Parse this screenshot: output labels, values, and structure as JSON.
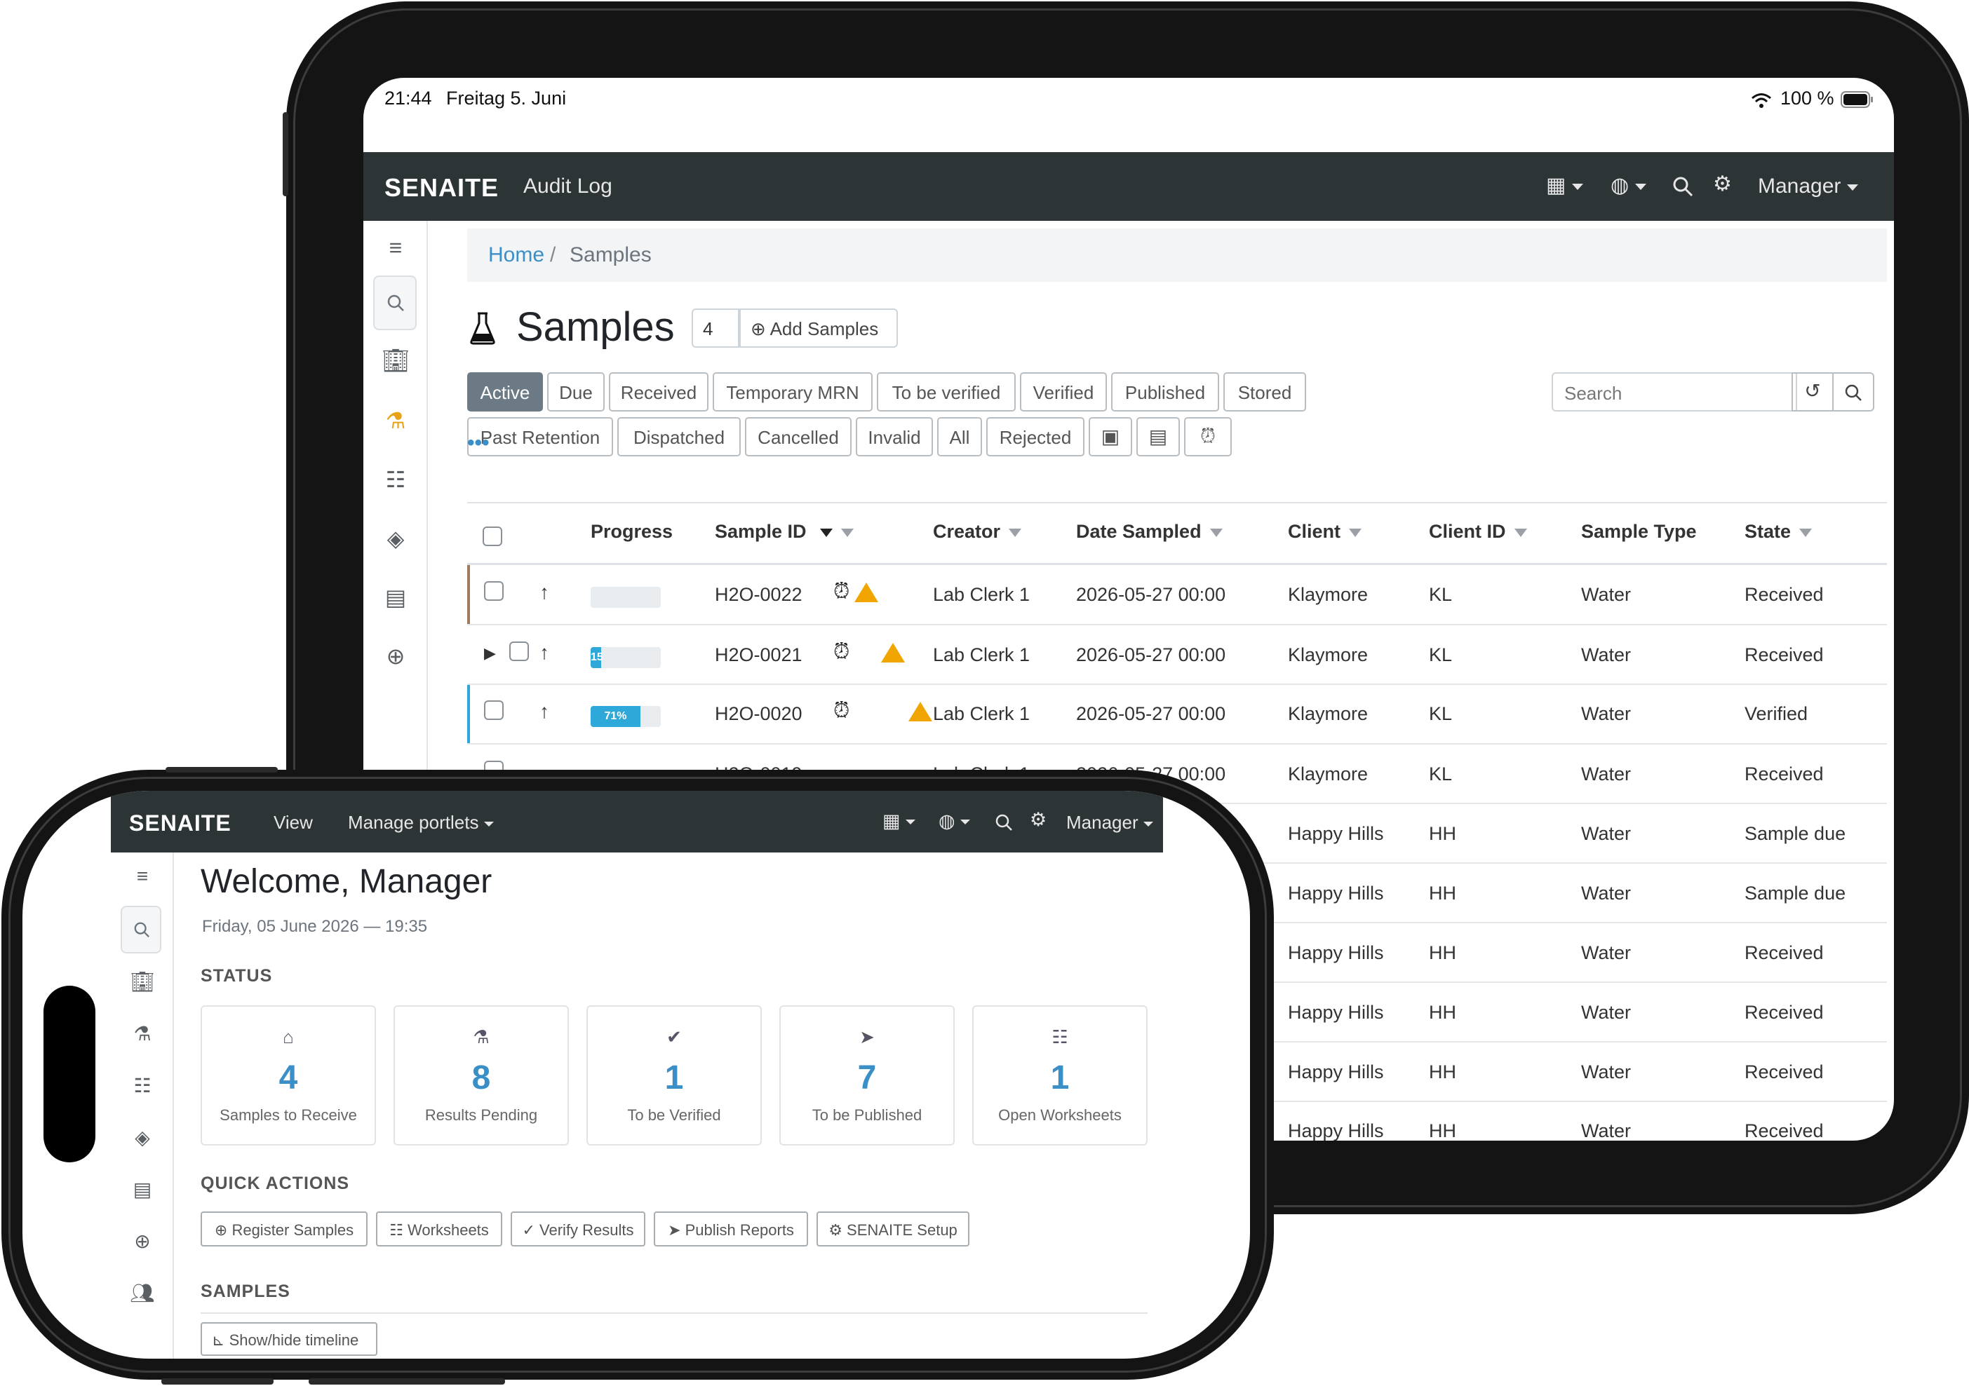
{
  "tablet": {
    "status_bar": {
      "time": "21:44",
      "date": "Freitag 5. Juni",
      "battery": "100 %"
    },
    "navbar": {
      "brand": "SENAITE",
      "link": "Audit Log",
      "user": "Manager"
    },
    "breadcrumb": {
      "home": "Home",
      "separator": "/",
      "current": "Samples"
    },
    "title": "Samples",
    "count_input": "4",
    "add_button": "Add Samples",
    "filters_row1": [
      "Active",
      "Due",
      "Received",
      "Temporary MRN",
      "To be verified",
      "Verified",
      "Published",
      "Stored"
    ],
    "filters_row2": [
      "Past Retention",
      "Dispatched",
      "Cancelled",
      "Invalid",
      "All",
      "Rejected"
    ],
    "active_filter": "Active",
    "search_placeholder": "Search",
    "more": "•••",
    "columns": [
      "Progress",
      "Sample ID",
      "Creator",
      "Date Sampled",
      "Client",
      "Client ID",
      "Sample Type",
      "State"
    ],
    "rows": [
      {
        "progress": "",
        "id": "H2O-0022",
        "creator": "Lab Clerk 1",
        "date": "2026-05-27 00:00",
        "client": "Klaymore",
        "client_id": "KL",
        "type": "Water",
        "state": "Received"
      },
      {
        "progress": "15",
        "id": "H2O-0021",
        "creator": "Lab Clerk 1",
        "date": "2026-05-27 00:00",
        "client": "Klaymore",
        "client_id": "KL",
        "type": "Water",
        "state": "Received"
      },
      {
        "progress": "71%",
        "id": "H2O-0020",
        "creator": "Lab Clerk 1",
        "date": "2026-05-27 00:00",
        "client": "Klaymore",
        "client_id": "KL",
        "type": "Water",
        "state": "Verified"
      },
      {
        "progress": "",
        "id": "H2O-0019",
        "creator": "Lab Clerk 1",
        "date": "2026-05-27 00:00",
        "client": "Klaymore",
        "client_id": "KL",
        "type": "Water",
        "state": "Received"
      },
      {
        "client": "Happy Hills",
        "client_id": "HH",
        "type": "Water",
        "state": "Sample due"
      },
      {
        "client": "Happy Hills",
        "client_id": "HH",
        "type": "Water",
        "state": "Sample due"
      },
      {
        "client": "Happy Hills",
        "client_id": "HH",
        "type": "Water",
        "state": "Received"
      },
      {
        "client": "Happy Hills",
        "client_id": "HH",
        "type": "Water",
        "state": "Received"
      },
      {
        "client": "Happy Hills",
        "client_id": "HH",
        "type": "Water",
        "state": "Received"
      },
      {
        "client": "Happy Hills",
        "client_id": "HH",
        "type": "Water",
        "state": "Received"
      }
    ],
    "progress_fractions": [
      0,
      0.15,
      0.71,
      0
    ]
  },
  "phone": {
    "navbar": {
      "brand": "SENAITE",
      "link_view": "View",
      "link_portlets": "Manage portlets",
      "user": "Manager"
    },
    "welcome": "Welcome, Manager",
    "date": "Friday, 05 June 2026 — 19:35",
    "status_title": "STATUS",
    "cards": [
      {
        "icon": "inbox-icon",
        "value": "4",
        "label": "Samples to Receive"
      },
      {
        "icon": "flask-icon",
        "value": "8",
        "label": "Results Pending"
      },
      {
        "icon": "check-circle-icon",
        "value": "1",
        "label": "To be Verified"
      },
      {
        "icon": "paper-plane-icon",
        "value": "7",
        "label": "To be Published"
      },
      {
        "icon": "worksheet-icon",
        "value": "1",
        "label": "Open Worksheets"
      }
    ],
    "quick_actions_title": "QUICK ACTIONS",
    "quick_actions": [
      "Register Samples",
      "Worksheets",
      "Verify Results",
      "Publish Reports",
      "SENAITE Setup"
    ],
    "samples_title": "SAMPLES",
    "timeline_button": "Show/hide timeline"
  },
  "colors": {
    "navbar": "#2d3436",
    "link": "#3a8fc7",
    "active_filter": "#6c7a86",
    "progress": "#2ea8d8",
    "warning": "#f0a500"
  }
}
